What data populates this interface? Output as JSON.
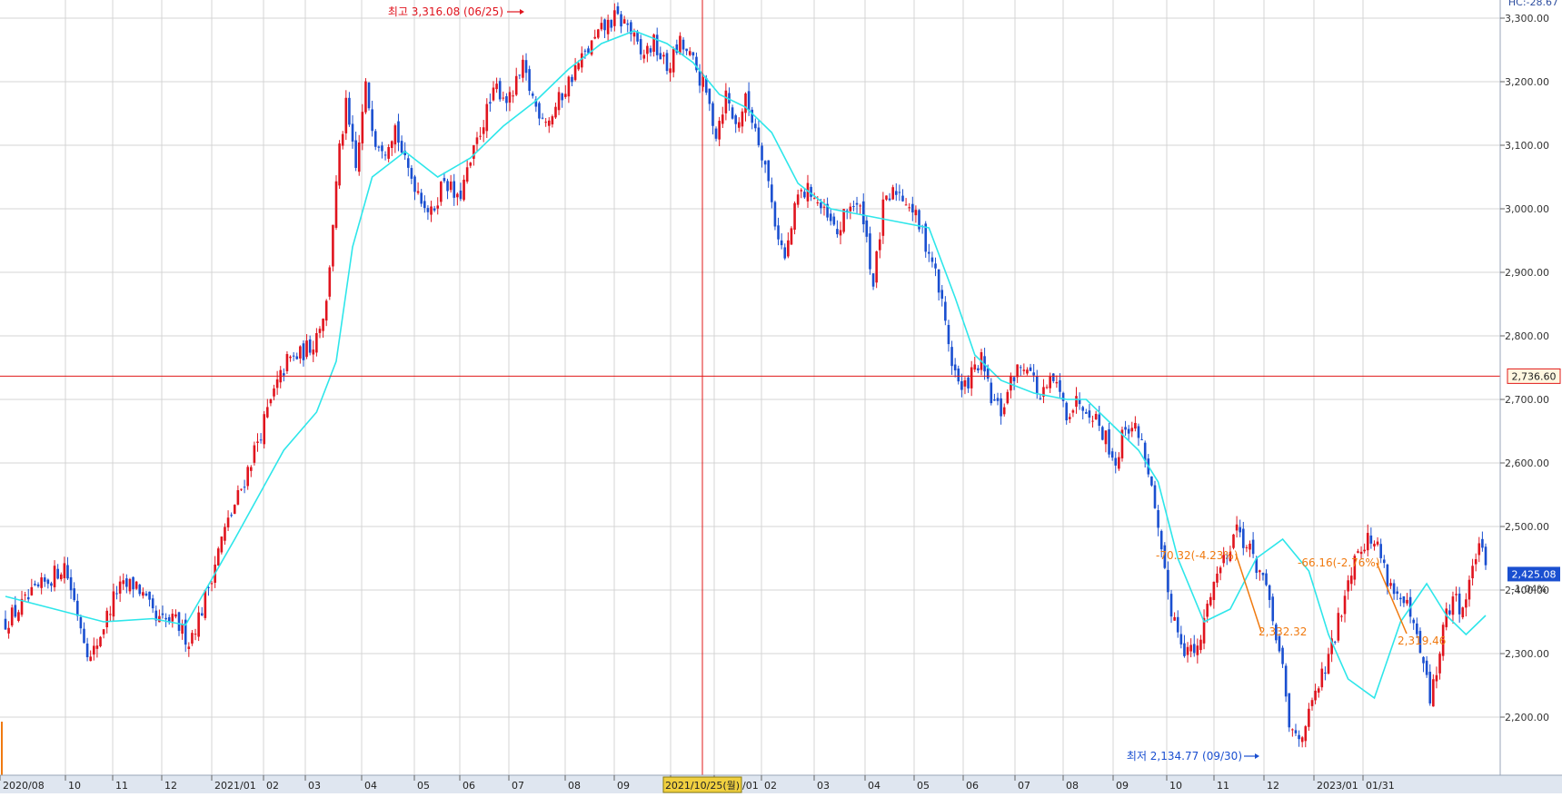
{
  "colors": {
    "up": "#e0141e",
    "down": "#1a4fd0",
    "ma": "#2ee6ea",
    "grid": "#d4d4d4",
    "crosshair": "#e01818",
    "axis_bg": "#dfe6f0",
    "price_box": "#1a4fd0",
    "annotation": "#f07a10"
  },
  "chart_data": {
    "type": "candlestick",
    "ylim": [
      2150,
      3320
    ],
    "y_ticks": [
      "3,300.00",
      "3,200.00",
      "3,100.00",
      "3,000.00",
      "2,900.00",
      "2,800.00",
      "2,700.00",
      "2,600.00",
      "2,500.00",
      "2,400.00",
      "2,300.00",
      "2,200.00"
    ],
    "x_ticks": [
      "2020/08",
      "10",
      "11",
      "12",
      "2021/01",
      "02",
      "03",
      "04",
      "05",
      "06",
      "07",
      "08",
      "09",
      "12",
      "2022/01",
      "02",
      "03",
      "04",
      "05",
      "06",
      "07",
      "08",
      "09",
      "10",
      "11",
      "12",
      "2023/01",
      "01/31"
    ],
    "crosshair": {
      "date_label": "2021/10/25(월)",
      "price_label": "2,736.60",
      "price": 2736.6
    },
    "current": {
      "price_label": "2,425.08",
      "change_label": "-1.04%",
      "price": 2425.08
    },
    "corner_label": "HC:-28.67",
    "high_note": {
      "label": "최고 3,316.08 (06/25)",
      "value": 3316.08
    },
    "low_note": {
      "label": "최저 2,134.77 (09/30)",
      "value": 2134.77
    },
    "annotations": [
      {
        "label": "-70.32(-4.23%)",
        "price": 2440
      },
      {
        "label": "2,332.32",
        "price": 2332.32
      },
      {
        "label": "-66.16(-2.76%)",
        "price": 2440
      },
      {
        "label": "2,319.46",
        "price": 2319.46
      }
    ],
    "anchors": [
      [
        0,
        2350
      ],
      [
        10,
        2400
      ],
      [
        18,
        2440
      ],
      [
        26,
        2290
      ],
      [
        34,
        2400
      ],
      [
        40,
        2410
      ],
      [
        46,
        2350
      ],
      [
        52,
        2350
      ],
      [
        56,
        2320
      ],
      [
        60,
        2370
      ],
      [
        66,
        2480
      ],
      [
        72,
        2560
      ],
      [
        78,
        2650
      ],
      [
        82,
        2710
      ],
      [
        86,
        2760
      ],
      [
        90,
        2770
      ],
      [
        94,
        2790
      ],
      [
        98,
        2850
      ],
      [
        100,
        2980
      ],
      [
        102,
        3090
      ],
      [
        104,
        3160
      ],
      [
        107,
        3060
      ],
      [
        110,
        3190
      ],
      [
        113,
        3110
      ],
      [
        116,
        3100
      ],
      [
        119,
        3130
      ],
      [
        122,
        3070
      ],
      [
        126,
        3030
      ],
      [
        130,
        2990
      ],
      [
        134,
        3050
      ],
      [
        138,
        3010
      ],
      [
        142,
        3070
      ],
      [
        146,
        3140
      ],
      [
        150,
        3190
      ],
      [
        154,
        3170
      ],
      [
        158,
        3220
      ],
      [
        162,
        3160
      ],
      [
        166,
        3140
      ],
      [
        170,
        3180
      ],
      [
        174,
        3220
      ],
      [
        178,
        3250
      ],
      [
        182,
        3280
      ],
      [
        186,
        3300
      ],
      [
        190,
        3290
      ],
      [
        194,
        3240
      ],
      [
        198,
        3260
      ],
      [
        202,
        3220
      ],
      [
        206,
        3260
      ],
      [
        210,
        3230
      ],
      [
        214,
        3180
      ],
      [
        217,
        3120
      ],
      [
        220,
        3180
      ],
      [
        223,
        3130
      ],
      [
        226,
        3170
      ],
      [
        229,
        3130
      ],
      [
        232,
        3070
      ],
      [
        235,
        2980
      ],
      [
        238,
        2920
      ],
      [
        242,
        3020
      ],
      [
        246,
        3030
      ],
      [
        250,
        2990
      ],
      [
        254,
        2960
      ],
      [
        258,
        3010
      ],
      [
        262,
        2990
      ],
      [
        265,
        2880
      ],
      [
        268,
        3000
      ],
      [
        272,
        3030
      ],
      [
        276,
        3010
      ],
      [
        280,
        2960
      ],
      [
        283,
        2920
      ],
      [
        286,
        2850
      ],
      [
        289,
        2760
      ],
      [
        292,
        2710
      ],
      [
        295,
        2740
      ],
      [
        298,
        2760
      ],
      [
        301,
        2700
      ],
      [
        304,
        2680
      ],
      [
        308,
        2740
      ],
      [
        312,
        2760
      ],
      [
        316,
        2700
      ],
      [
        320,
        2730
      ],
      [
        324,
        2680
      ],
      [
        328,
        2700
      ],
      [
        332,
        2680
      ],
      [
        336,
        2640
      ],
      [
        339,
        2600
      ],
      [
        342,
        2660
      ],
      [
        346,
        2650
      ],
      [
        349,
        2590
      ],
      [
        351,
        2520
      ],
      [
        353,
        2450
      ],
      [
        356,
        2370
      ],
      [
        360,
        2310
      ],
      [
        364,
        2300
      ],
      [
        368,
        2400
      ],
      [
        372,
        2450
      ],
      [
        376,
        2500
      ],
      [
        378,
        2480
      ],
      [
        381,
        2450
      ],
      [
        384,
        2420
      ],
      [
        386,
        2370
      ],
      [
        388,
        2330
      ],
      [
        390,
        2270
      ],
      [
        392,
        2180
      ],
      [
        395,
        2170
      ],
      [
        398,
        2200
      ],
      [
        401,
        2250
      ],
      [
        404,
        2290
      ],
      [
        407,
        2350
      ],
      [
        410,
        2420
      ],
      [
        413,
        2470
      ],
      [
        416,
        2480
      ],
      [
        419,
        2470
      ],
      [
        422,
        2420
      ],
      [
        425,
        2390
      ],
      [
        428,
        2370
      ],
      [
        431,
        2320
      ],
      [
        433,
        2280
      ],
      [
        435,
        2230
      ],
      [
        437,
        2270
      ],
      [
        439,
        2340
      ],
      [
        442,
        2390
      ],
      [
        445,
        2370
      ],
      [
        448,
        2430
      ],
      [
        450,
        2480
      ],
      [
        452,
        2425
      ]
    ],
    "ma_points": [
      [
        0,
        2390
      ],
      [
        15,
        2370
      ],
      [
        30,
        2350
      ],
      [
        45,
        2355
      ],
      [
        55,
        2345
      ],
      [
        70,
        2480
      ],
      [
        85,
        2620
      ],
      [
        95,
        2680
      ],
      [
        101,
        2760
      ],
      [
        106,
        2940
      ],
      [
        112,
        3050
      ],
      [
        122,
        3090
      ],
      [
        132,
        3050
      ],
      [
        142,
        3080
      ],
      [
        152,
        3130
      ],
      [
        162,
        3170
      ],
      [
        172,
        3220
      ],
      [
        182,
        3260
      ],
      [
        192,
        3280
      ],
      [
        202,
        3260
      ],
      [
        210,
        3230
      ],
      [
        218,
        3180
      ],
      [
        226,
        3160
      ],
      [
        234,
        3120
      ],
      [
        242,
        3040
      ],
      [
        252,
        3000
      ],
      [
        262,
        2990
      ],
      [
        272,
        2980
      ],
      [
        282,
        2970
      ],
      [
        290,
        2860
      ],
      [
        296,
        2770
      ],
      [
        304,
        2730
      ],
      [
        314,
        2710
      ],
      [
        324,
        2700
      ],
      [
        330,
        2700
      ],
      [
        338,
        2660
      ],
      [
        346,
        2620
      ],
      [
        352,
        2570
      ],
      [
        358,
        2450
      ],
      [
        366,
        2350
      ],
      [
        374,
        2370
      ],
      [
        382,
        2450
      ],
      [
        390,
        2480
      ],
      [
        398,
        2430
      ],
      [
        404,
        2330
      ],
      [
        410,
        2260
      ],
      [
        418,
        2230
      ],
      [
        426,
        2350
      ],
      [
        434,
        2410
      ],
      [
        440,
        2360
      ],
      [
        446,
        2330
      ],
      [
        452,
        2360
      ]
    ]
  }
}
